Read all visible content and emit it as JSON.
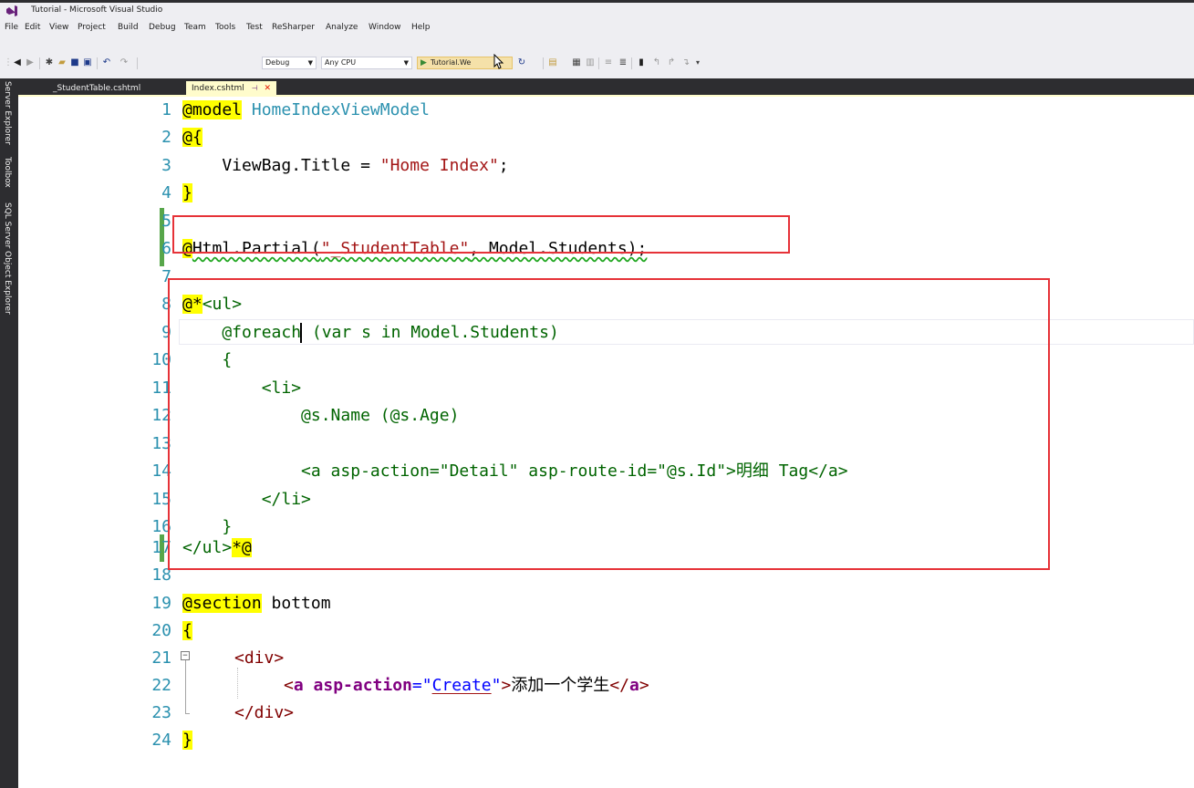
{
  "window": {
    "title": "Tutorial - Microsoft Visual Studio"
  },
  "menu": [
    "File",
    "Edit",
    "View",
    "Project",
    "Build",
    "Debug",
    "Team",
    "Tools",
    "Test",
    "ReSharper",
    "Analyze",
    "Window",
    "Help"
  ],
  "toolbar": {
    "configuration": "Debug",
    "platform": "Any CPU",
    "run_target": "Tutorial.We"
  },
  "side_tabs": [
    "Server Explorer",
    "Toolbox",
    "SQL Server Object Explorer"
  ],
  "tabs": [
    {
      "label": "_StudentTable.cshtml",
      "active": false
    },
    {
      "label": "Index.cshtml",
      "active": true
    }
  ],
  "editor": {
    "line_numbers": [
      "1",
      "2",
      "3",
      "4",
      "5",
      "6",
      "7",
      "8",
      "9",
      "10",
      "11",
      "12",
      "13",
      "14",
      "15",
      "16",
      "17",
      "18",
      "19",
      "20",
      "21",
      "22",
      "23",
      "24"
    ],
    "code": {
      "l1_directive": "@model",
      "l1_type": "HomeIndexViewModel",
      "l2_open": "@{",
      "l3_prefix": "    ViewBag.Title = ",
      "l3_string": "\"Home Index\"",
      "l3_suffix": ";",
      "l4_close": "}",
      "l6_at": "@",
      "l6_code": "Html.Partial(",
      "l6_string": "\"_StudentTable\"",
      "l6_suffix": ", Model.Students);",
      "l8_comment_open": "@*",
      "l8_rest": "<ul>",
      "l9_a": "    @foreach",
      "l9_b": " (var s in Model.Students)",
      "l10": "    {",
      "l11": "        <li>",
      "l12": "            @s.Name (@s.Age)",
      "l14": "            <a asp-action=\"Detail\" asp-route-id=\"@s.Id\">明细 Tag</a>",
      "l15": "        </li>",
      "l16": "    }",
      "l17_prefix": "</ul>",
      "l17_comment_close": "*@",
      "l19_directive": "@section",
      "l19_name": " bottom",
      "l20_open": "{",
      "l21_tag": "<div>",
      "l22_lt": "<",
      "l22_tag": "a",
      "l22_attr": " asp-action",
      "l22_eq": "=",
      "l22_q1": "\"",
      "l22_val": "Create",
      "l22_q2": "\"",
      "l22_gt": ">",
      "l22_text": "添加一个学生",
      "l22_close_lt": "</",
      "l22_close_tag": "a",
      "l22_close_gt": ">",
      "l23_tag": "</div>",
      "l24_close": "}"
    }
  },
  "colors": {
    "razor_highlight": "#ffff00",
    "keyword": "#0000ff",
    "type": "#2b91af",
    "string": "#a31515",
    "tag": "#800000",
    "comment": "#006400",
    "annotation_box": "#e63238",
    "change_bar": "#57a64a",
    "active_tab": "#fffccc"
  }
}
